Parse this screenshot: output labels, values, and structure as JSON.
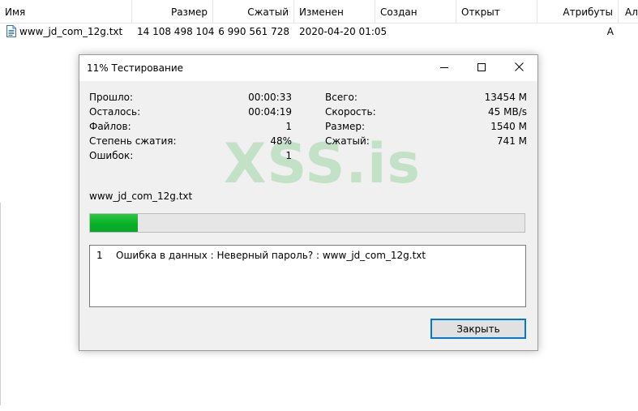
{
  "file_list": {
    "columns": [
      "Имя",
      "Размер",
      "Сжатый",
      "Изменен",
      "Создан",
      "Открыт",
      "Атрибуты",
      "Ал"
    ],
    "rows": [
      {
        "name": "www_jd_com_12g.txt",
        "size": "14 108 498 104",
        "packed": "6 990 561 728",
        "modified": "2020-04-20 01:05",
        "created": "",
        "accessed": "",
        "attributes": "A",
        "alt": ""
      }
    ],
    "file_icon": "text-file-icon"
  },
  "dialog": {
    "title": "11% Тестирование",
    "icons": {
      "minimize": "minimize-icon",
      "maximize": "maximize-icon",
      "close": "close-icon"
    },
    "stats_left": [
      {
        "label": "Прошло:",
        "value": "00:00:33"
      },
      {
        "label": "Осталось:",
        "value": "00:04:19"
      },
      {
        "label": "Файлов:",
        "value": "1"
      },
      {
        "label": "Степень сжатия:",
        "value": "48%"
      },
      {
        "label": "Ошибок:",
        "value": "1"
      }
    ],
    "stats_right": [
      {
        "label": "Всего:",
        "value": "13454 M"
      },
      {
        "label": "Скорость:",
        "value": "45 MB/s"
      },
      {
        "label": "Размер:",
        "value": "1540 M"
      },
      {
        "label": "Сжатый:",
        "value": "741 M"
      }
    ],
    "watermark": "XSS.is",
    "current_file": "www_jd_com_12g.txt",
    "progress_percent": 11,
    "progress_color": "#06b025",
    "messages": [
      {
        "num": "1",
        "text": "Ошибка в данных : Неверный пароль? : www_jd_com_12g.txt"
      }
    ],
    "close_button": "Закрыть"
  }
}
